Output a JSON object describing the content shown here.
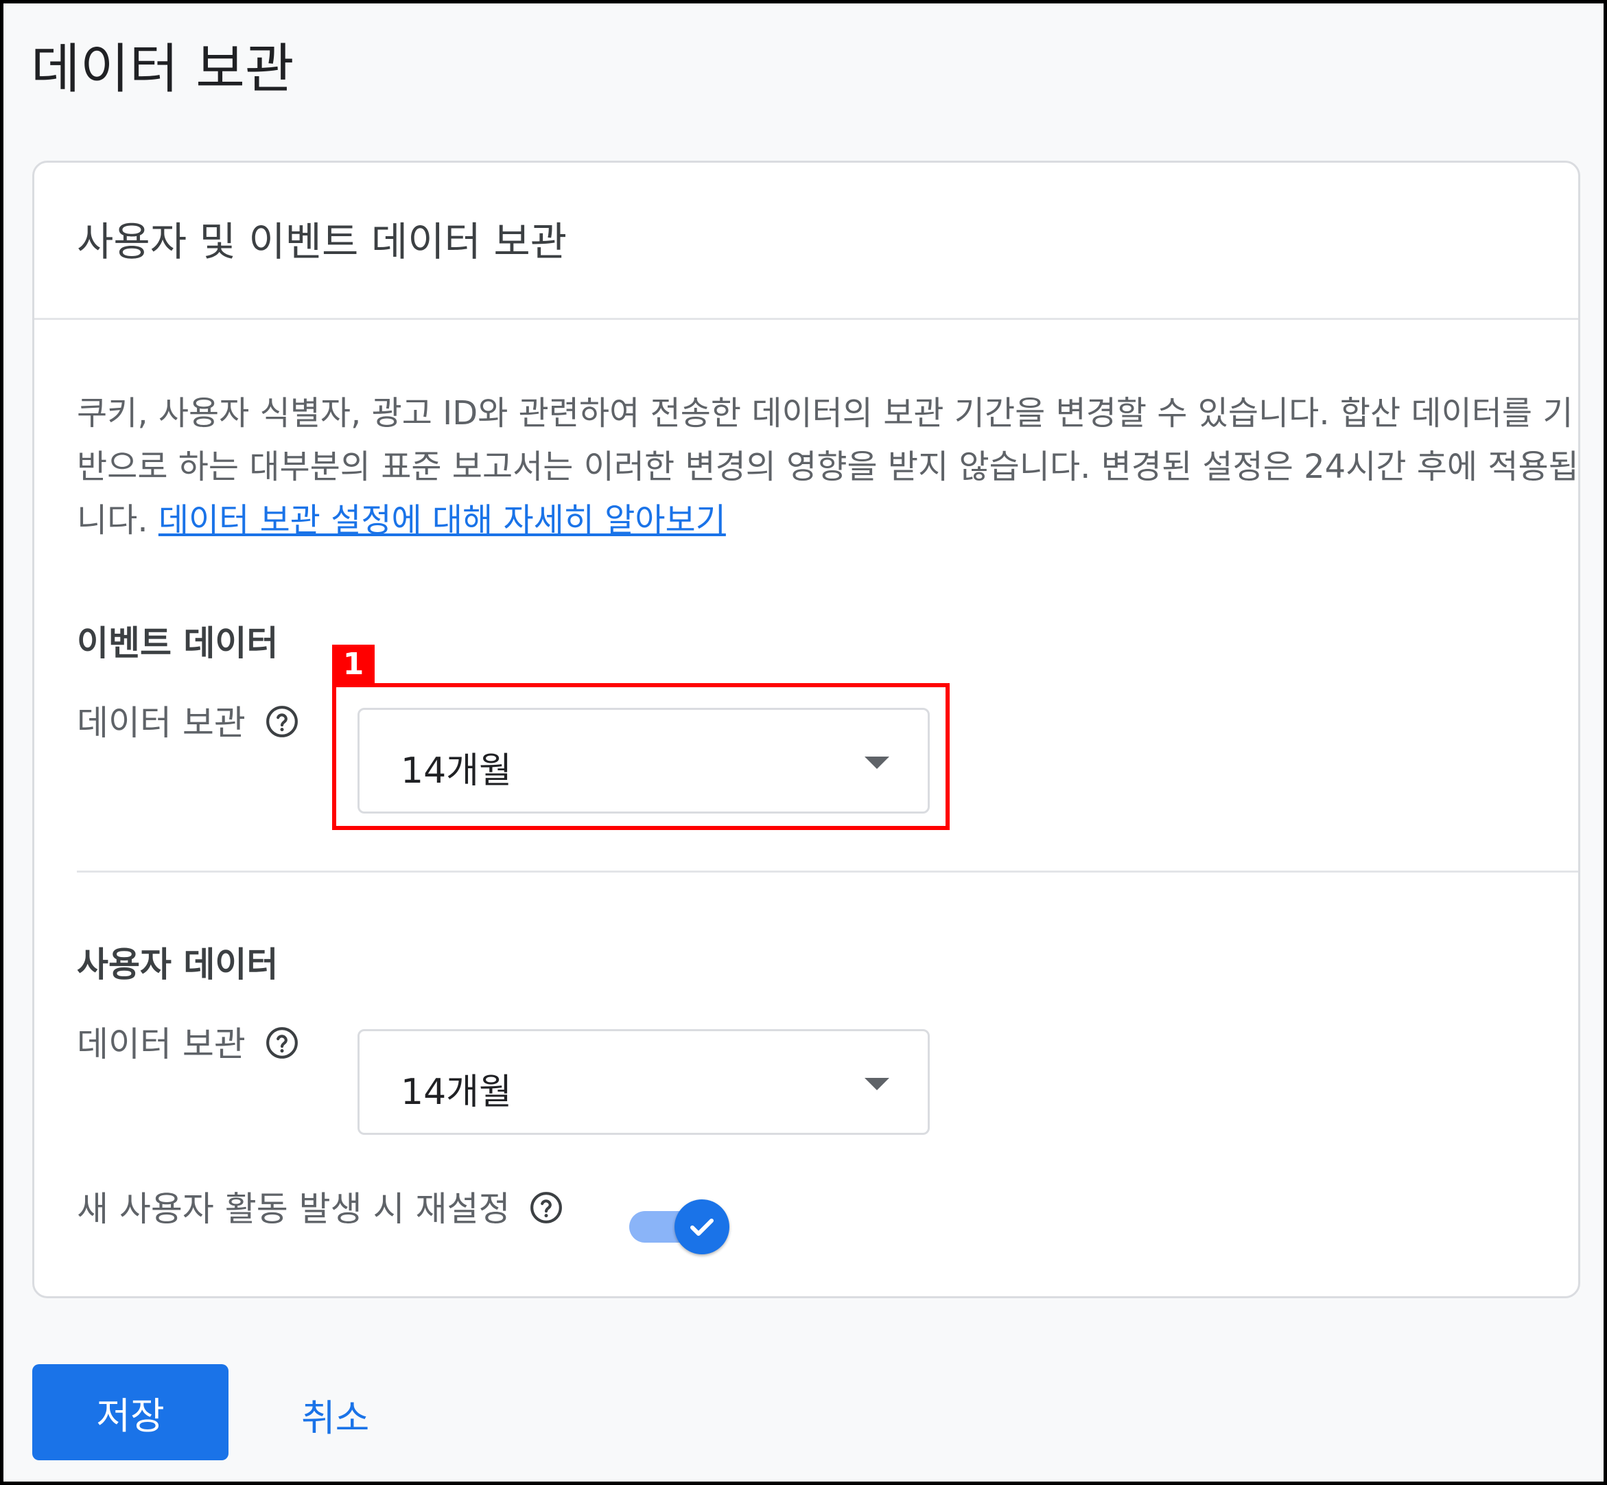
{
  "page": {
    "title": "데이터 보관"
  },
  "card": {
    "title": "사용자 및 이벤트 데이터 보관",
    "description": "쿠키, 사용자 식별자, 광고 ID와 관련하여 전송한 데이터의 보관 기간을 변경할 수 있습니다. 합산 데이터를 기반으로 하는 대부분의 표준 보고서는 이러한 변경의 영향을 받지 않습니다. 변경된 설정은 24시간 후에 적용됩니다.",
    "learn_more_link": "데이터 보관 설정에 대해 자세히 알아보기"
  },
  "event_data": {
    "section_title": "이벤트 데이터",
    "retention_label": "데이터 보관",
    "retention_value": "14개월"
  },
  "user_data": {
    "section_title": "사용자 데이터",
    "retention_label": "데이터 보관",
    "retention_value": "14개월",
    "reset_label": "새 사용자 활동 발생 시 재설정",
    "reset_enabled": true
  },
  "annotation": {
    "badge": "1",
    "color": "#ff0000"
  },
  "actions": {
    "save_label": "저장",
    "cancel_label": "취소"
  },
  "colors": {
    "accent": "#1a73e8",
    "toggle_track": "#8ab4f8"
  },
  "icons": {
    "help": "help-circle-icon",
    "dropdown": "caret-down-icon",
    "toggle_check": "check-icon"
  }
}
